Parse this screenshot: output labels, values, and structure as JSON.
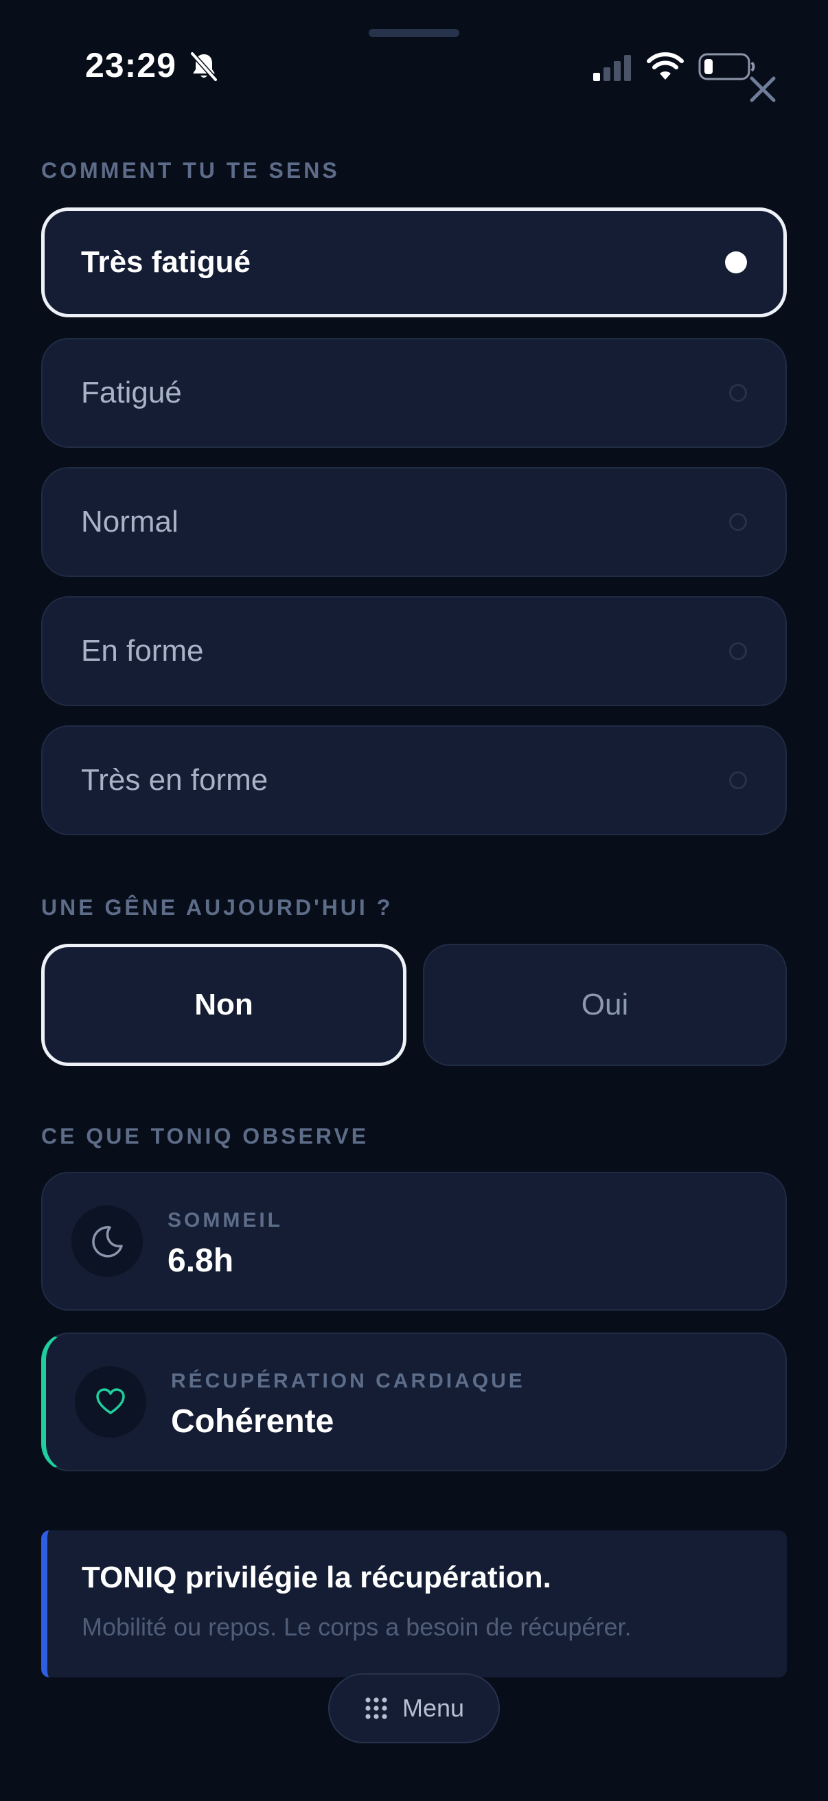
{
  "status_bar": {
    "time": "23:29"
  },
  "mood": {
    "section_label": "COMMENT TU TE SENS",
    "options": [
      {
        "label": "Très fatigué",
        "selected": true
      },
      {
        "label": "Fatigué",
        "selected": false
      },
      {
        "label": "Normal",
        "selected": false
      },
      {
        "label": "En forme",
        "selected": false
      },
      {
        "label": "Très en forme",
        "selected": false
      }
    ]
  },
  "discomfort": {
    "section_label": "UNE GÊNE AUJOURD'HUI ?",
    "options": [
      {
        "label": "Non",
        "selected": true
      },
      {
        "label": "Oui",
        "selected": false
      }
    ]
  },
  "observations": {
    "section_label": "CE QUE TONIQ OBSERVE",
    "sleep": {
      "label": "SOMMEIL",
      "value": "6.8h",
      "icon": "moon-icon"
    },
    "heart": {
      "label": "RÉCUPÉRATION CARDIAQUE",
      "value": "Cohérente",
      "icon": "heart-icon",
      "accent_color": "#1fcf9e"
    }
  },
  "recommendation": {
    "title": "TONIQ privilégie la récupération.",
    "text": "Mobilité ou repos. Le corps a besoin de récupérer.",
    "accent_color": "#2f5fe0"
  },
  "menu": {
    "label": "Menu",
    "icon": "grid-dots-icon"
  },
  "icons": {
    "close": "close-icon",
    "bell": "bell-slash-icon",
    "signal": "cellular-signal-icon",
    "wifi": "wifi-icon",
    "battery": "battery-low-icon"
  }
}
